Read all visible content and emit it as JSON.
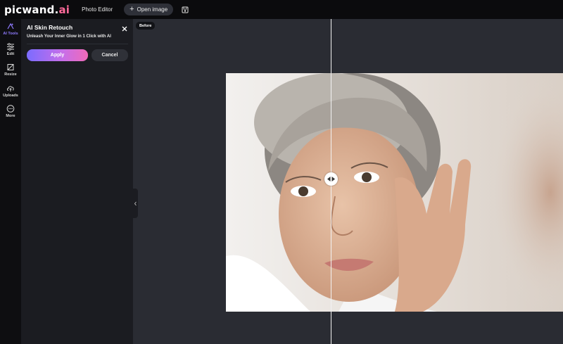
{
  "topbar": {
    "logo_main": "picwand.",
    "logo_ai": "ai",
    "photo_editor": "Photo Editor",
    "open_image": "Open image",
    "open_image_icon": "plus-icon",
    "save_icon": "save-icon"
  },
  "rail": {
    "items": [
      {
        "label": "AI Tools",
        "icon": "ai-sparkle-icon",
        "active": true
      },
      {
        "label": "Edit",
        "icon": "sliders-icon",
        "active": false
      },
      {
        "label": "Resize",
        "icon": "crop-icon",
        "active": false
      },
      {
        "label": "Uploads",
        "icon": "cloud-upload-icon",
        "active": false
      },
      {
        "label": "More",
        "icon": "more-icon",
        "active": false
      }
    ]
  },
  "panel": {
    "title": "AI Skin Retouch",
    "subtitle": "Unleash Your Inner Glow in 1 Click with AI",
    "apply_label": "Apply",
    "cancel_label": "Cancel"
  },
  "canvas": {
    "before_label": "Before"
  },
  "colors": {
    "accent": "#8f7bff",
    "logo_ai": "#ff6a9a",
    "apply_gradient_start": "#7b6cff",
    "apply_gradient_end": "#f06ab8"
  }
}
